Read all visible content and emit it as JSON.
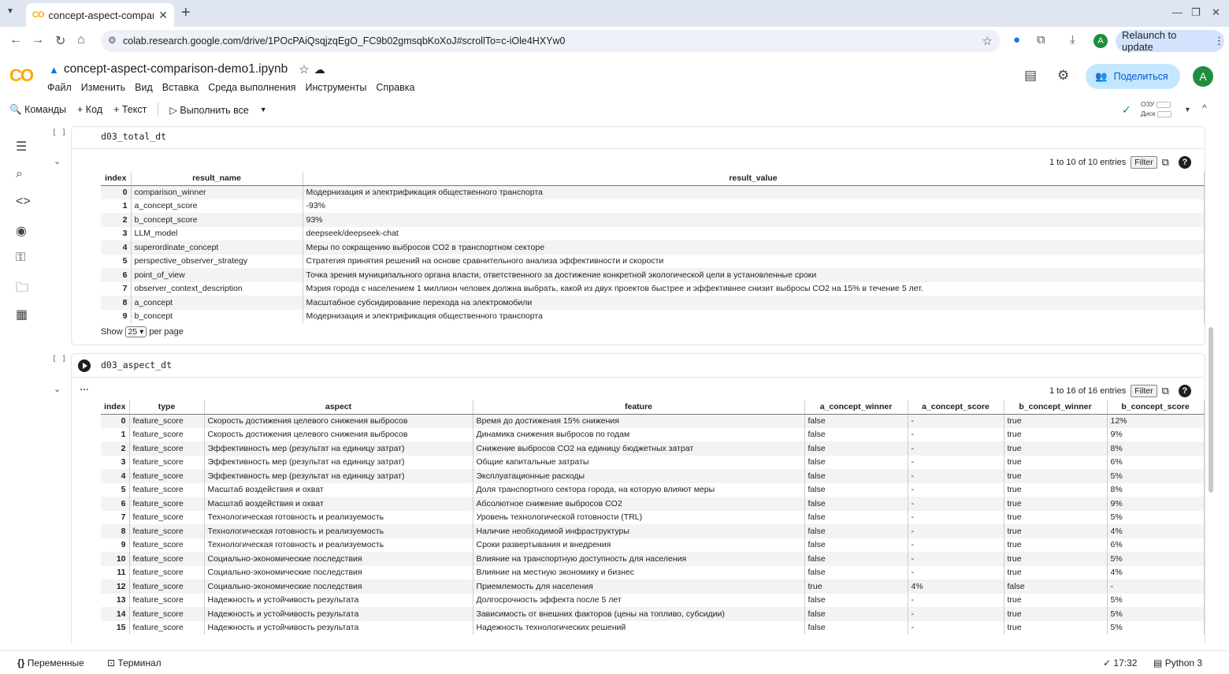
{
  "browser": {
    "tab_title": "concept-aspect-compari",
    "tab_favicon": "CO",
    "url": "colab.research.google.com/drive/1POcPAiQsqjzqEgO_FC9b02gmsqbKoXoJ#scrollTo=c-iOle4HXYw0",
    "relaunch_label": "Relaunch to update",
    "profile_initial": "A"
  },
  "colab": {
    "logo": "CO",
    "notebook_title": "concept-aspect-comparison-demo1.ipynb",
    "menu": [
      "Файл",
      "Изменить",
      "Вид",
      "Вставка",
      "Среда выполнения",
      "Инструменты",
      "Справка"
    ],
    "share_label": "Поделиться",
    "avatar_initial": "A",
    "toolbar": {
      "commands": "Команды",
      "code": "+ Код",
      "text": "+ Текст",
      "run_all": "Выполнить все"
    },
    "ram_label": "ОЗУ",
    "disk_label": "Диск"
  },
  "cell1": {
    "bracket": "[ ]",
    "code": "d03_total_dt",
    "entries": "1 to 10 of 10 entries",
    "filter": "Filter",
    "columns": [
      "index",
      "result_name",
      "result_value"
    ],
    "rows": [
      [
        "0",
        "comparison_winner",
        "Модернизация и электрификация общественного транспорта"
      ],
      [
        "1",
        "a_concept_score",
        "-93%"
      ],
      [
        "2",
        "b_concept_score",
        "93%"
      ],
      [
        "3",
        "LLM_model",
        "deepseek/deepseek-chat"
      ],
      [
        "4",
        "superordinate_concept",
        "Меры по сокращению выбросов CO2 в транспортном секторе"
      ],
      [
        "5",
        "perspective_observer_strategy",
        "Стратегия принятия решений на основе сравнительного анализа эффективности и скорости"
      ],
      [
        "6",
        "point_of_view",
        "Точка зрения муниципального органа власти, ответственного за достижение конкретной экологической цели в установленные сроки"
      ],
      [
        "7",
        "observer_context_description",
        "Мэрия города с населением 1 миллион человек должна выбрать, какой из двух проектов быстрее и эффективнее снизит выбросы CO2 на 15% в течение 5 лет."
      ],
      [
        "8",
        "a_concept",
        "Масштабное субсидирование перехода на электромобили"
      ],
      [
        "9",
        "b_concept",
        "Модернизация и электрификация общественного транспорта"
      ]
    ],
    "show_label": "Show",
    "per_page_value": "25",
    "per_page_label": "per page"
  },
  "cell2": {
    "bracket": "[ ]",
    "code": "d03_aspect_dt",
    "entries": "1 to 16 of 16 entries",
    "filter": "Filter",
    "columns": [
      "index",
      "type",
      "aspect",
      "feature",
      "a_concept_winner",
      "a_concept_score",
      "b_concept_winner",
      "b_concept_score"
    ],
    "rows": [
      [
        "0",
        "feature_score",
        "Скорость достижения целевого снижения выбросов",
        "Время до достижения 15% снижения",
        "false",
        "-",
        "true",
        "12%"
      ],
      [
        "1",
        "feature_score",
        "Скорость достижения целевого снижения выбросов",
        "Динамика снижения выбросов по годам",
        "false",
        "-",
        "true",
        "9%"
      ],
      [
        "2",
        "feature_score",
        "Эффективность мер (результат на единицу затрат)",
        "Снижение выбросов CO2 на единицу бюджетных затрат",
        "false",
        "-",
        "true",
        "8%"
      ],
      [
        "3",
        "feature_score",
        "Эффективность мер (результат на единицу затрат)",
        "Общие капитальные затраты",
        "false",
        "-",
        "true",
        "6%"
      ],
      [
        "4",
        "feature_score",
        "Эффективность мер (результат на единицу затрат)",
        "Эксплуатационные расходы",
        "false",
        "-",
        "true",
        "5%"
      ],
      [
        "5",
        "feature_score",
        "Масштаб воздействия и охват",
        "Доля транспортного сектора города, на которую влияют меры",
        "false",
        "-",
        "true",
        "8%"
      ],
      [
        "6",
        "feature_score",
        "Масштаб воздействия и охват",
        "Абсолютное снижение выбросов CO2",
        "false",
        "-",
        "true",
        "9%"
      ],
      [
        "7",
        "feature_score",
        "Технологическая готовность и реализуемость",
        "Уровень технологической готовности (TRL)",
        "false",
        "-",
        "true",
        "5%"
      ],
      [
        "8",
        "feature_score",
        "Технологическая готовность и реализуемость",
        "Наличие необходимой инфраструктуры",
        "false",
        "-",
        "true",
        "4%"
      ],
      [
        "9",
        "feature_score",
        "Технологическая готовность и реализуемость",
        "Сроки развертывания и внедрения",
        "false",
        "-",
        "true",
        "6%"
      ],
      [
        "10",
        "feature_score",
        "Социально-экономические последствия",
        "Влияние на транспортную доступность для населения",
        "false",
        "-",
        "true",
        "5%"
      ],
      [
        "11",
        "feature_score",
        "Социально-экономические последствия",
        "Влияние на местную экономику и бизнес",
        "false",
        "-",
        "true",
        "4%"
      ],
      [
        "12",
        "feature_score",
        "Социально-экономические последствия",
        "Приемлемость для населения",
        "true",
        "4%",
        "false",
        "-"
      ],
      [
        "13",
        "feature_score",
        "Надежность и устойчивость результата",
        "Долгосрочность эффекта после 5 лет",
        "false",
        "-",
        "true",
        "5%"
      ],
      [
        "14",
        "feature_score",
        "Надежность и устойчивость результата",
        "Зависимость от внешних факторов (цены на топливо, субсидии)",
        "false",
        "-",
        "true",
        "5%"
      ],
      [
        "15",
        "feature_score",
        "Надежность и устойчивость результата",
        "Надежность технологических решений",
        "false",
        "-",
        "true",
        "5%"
      ]
    ]
  },
  "statusbar": {
    "variables": "Переменные",
    "terminal": "Терминал",
    "time": "17:32",
    "runtime": "Python 3"
  }
}
